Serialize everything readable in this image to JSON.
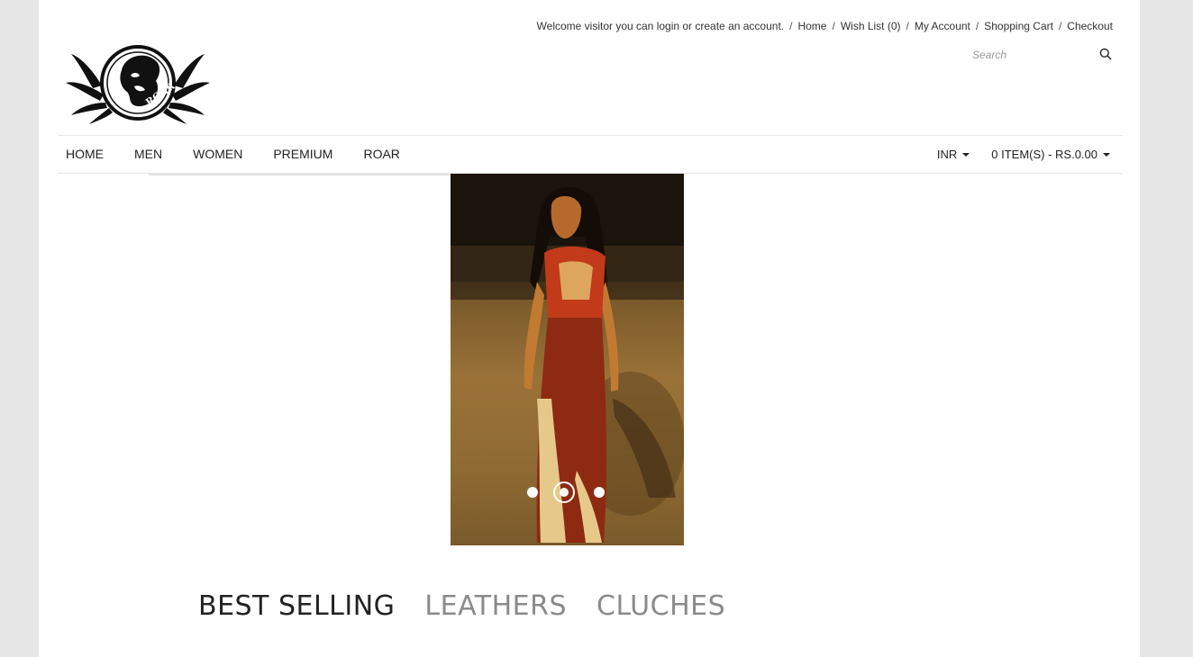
{
  "header": {
    "welcome": "Welcome visitor you can login or create an account.",
    "links": [
      "Home",
      "Wish List (0)",
      "My Account",
      "Shopping Cart",
      "Checkout"
    ],
    "search_placeholder": "Search",
    "logo_text": "ROAR"
  },
  "nav": {
    "items": [
      "HOME",
      "MEN",
      "WOMEN",
      "PREMIUM",
      "ROAR"
    ],
    "currency": "INR",
    "cart": "0 ITEM(S) - RS.0.00"
  },
  "slider": {
    "dot_count": 3,
    "active_index": 1
  },
  "tabs": [
    {
      "label": "BEST SELLING",
      "active": true
    },
    {
      "label": "LEATHERS",
      "active": false
    },
    {
      "label": "CLUCHES",
      "active": false
    }
  ],
  "colors": {
    "page_bg": "#e6e6e6",
    "content_bg": "#ffffff",
    "active_tab": "#222222",
    "inactive_tab": "#8a8a8a"
  }
}
